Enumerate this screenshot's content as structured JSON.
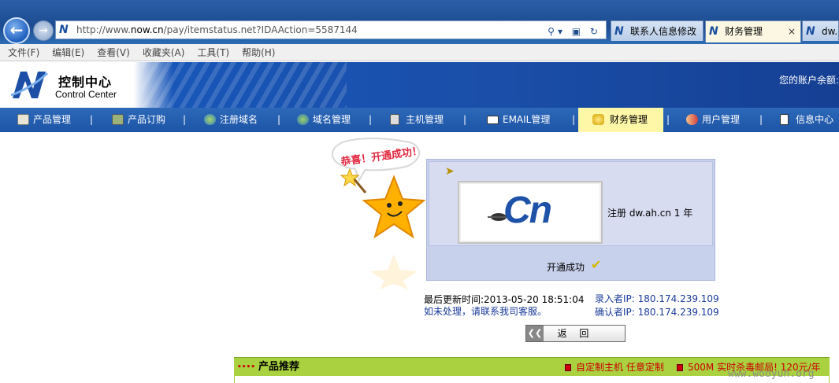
{
  "browser": {
    "url_prefix": "http://www.",
    "url_host": "now.cn",
    "url_path": "/pay/itemstatus.net?IDAAction=5587144",
    "tabs": [
      {
        "label": "联系人信息修改",
        "active": false
      },
      {
        "label": "财务管理",
        "active": true
      },
      {
        "label": "dw.a",
        "active": false
      }
    ]
  },
  "menu": [
    "文件(F)",
    "编辑(E)",
    "查看(V)",
    "收藏夹(A)",
    "工具(T)",
    "帮助(H)"
  ],
  "header": {
    "title": "控制中心",
    "subtitle": "Control Center",
    "balance_label": "您的账户余额:"
  },
  "nav": [
    {
      "label": "产品管理",
      "icon": "product-icon",
      "active": false
    },
    {
      "label": "产品订购",
      "icon": "cart-icon",
      "active": false
    },
    {
      "label": "注册域名",
      "icon": "globe-pen-icon",
      "active": false
    },
    {
      "label": "域名管理",
      "icon": "globe-icon",
      "active": false
    },
    {
      "label": "主机管理",
      "icon": "server-icon",
      "active": false
    },
    {
      "label": "EMAIL管理",
      "icon": "mail-icon",
      "active": false
    },
    {
      "label": "财务管理",
      "icon": "coins-icon",
      "active": true
    },
    {
      "label": "用户管理",
      "icon": "users-icon",
      "active": false
    },
    {
      "label": "信息中心",
      "icon": "document-icon",
      "active": false
    }
  ],
  "mascot": {
    "bubble_text": "恭喜！开通成功！"
  },
  "order": {
    "logo_text": "Cn",
    "reg_text": "注册  dw.ah.cn 1 年",
    "success_text": "开通成功"
  },
  "status": {
    "updated": "最后更新时间:2013-05-20 18:51:04",
    "contact": "如未处理，请联系我司客服。",
    "entry_ip": "录入者IP: 180.174.239.109",
    "confirm_ip": "确认者IP: 180.174.239.109"
  },
  "back_button": "返 回",
  "recommend": {
    "title": "产品推荐",
    "links": [
      "自定制主机  任意定制",
      "500M 实时杀毒邮局! 120元/年"
    ]
  },
  "watermark": "www.wooyun.org",
  "colors": {
    "nav_bg": "#1d55a6",
    "nav_active": "#fff7a8",
    "rec_bar": "#a9d140",
    "link_red": "#cc0000"
  }
}
